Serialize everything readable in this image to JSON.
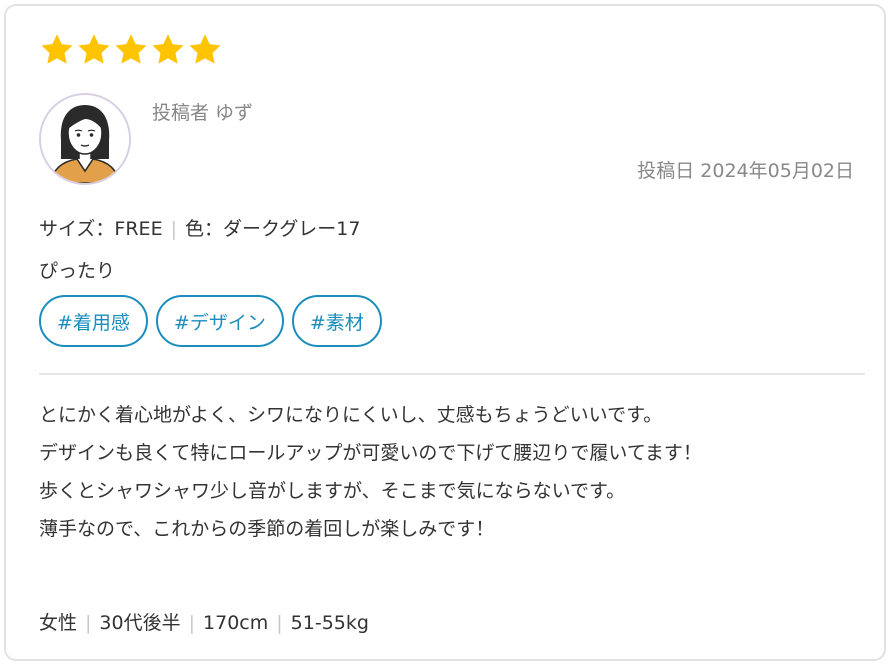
{
  "review": {
    "rating": 5,
    "star_color": "#ffc400",
    "poster_label": "投稿者 ゆず",
    "date_label": "投稿日 2024年05月02日",
    "size_label": "サイズ：FREE",
    "color_label": "色：ダークグレー17",
    "fit": "ぴったり",
    "tags": [
      "#着用感",
      "#デザイン",
      "#素材"
    ],
    "tag_color": "#1a8dbd",
    "body_lines": [
      "とにかく着心地がよく、シワになりにくいし、丈感もちょうどいいです。",
      "デザインも良くて特にロールアップが可愛いので下げて腰辺りで履いてます！",
      "歩くとシャワシャワ少し音がしますが、そこまで気にならないです。",
      "薄手なので、これからの季節の着回しが楽しみです！"
    ],
    "profile": {
      "gender": "女性",
      "age": "30代後半",
      "height": "170cm",
      "weight": "51-55kg"
    },
    "avatar_icon": "woman-avatar-icon"
  }
}
